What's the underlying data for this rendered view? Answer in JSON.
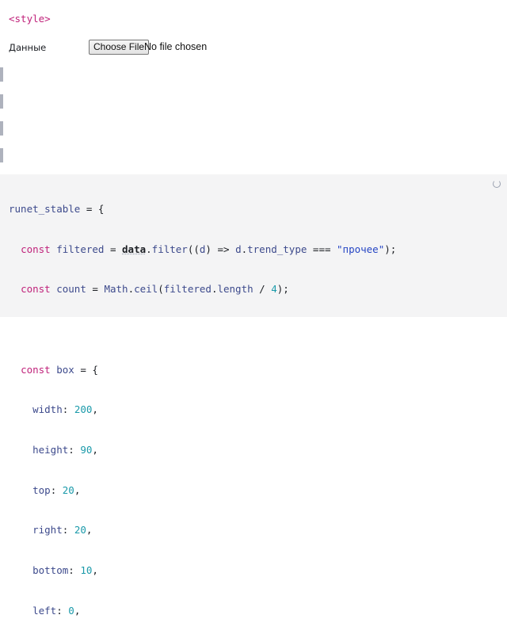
{
  "style_cell": {
    "text": "<style>"
  },
  "file_input": {
    "label": "Данные",
    "button_label": "Choose File",
    "status": "No file chosen"
  },
  "code": {
    "line1": {
      "name": "runet_stable",
      "op": " = {"
    },
    "line2": {
      "kw": "const",
      "name": "filtered",
      "eq": " = ",
      "ref": "data",
      "dot": ".",
      "method": "filter",
      "open": "((",
      "param": "d",
      "arrow": ") => ",
      "param2": "d",
      "dot2": ".",
      "prop": "trend_type",
      "cmp": " === ",
      "str": "\"прочее\"",
      "close": ");"
    },
    "line3": {
      "kw": "const",
      "name": "count",
      "eq": " = ",
      "obj": "Math",
      "dot": ".",
      "method": "ceil",
      "open": "(",
      "arg": "filtered",
      "dot2": ".",
      "prop": "length",
      "div": " / ",
      "num": "4",
      "close": ");"
    },
    "line5": {
      "kw": "const",
      "name": "box",
      "op": " = {"
    },
    "box_props": [
      {
        "key": "width",
        "value": "200"
      },
      {
        "key": "height",
        "value": "90"
      },
      {
        "key": "top",
        "value": "20"
      },
      {
        "key": "right",
        "value": "20"
      },
      {
        "key": "bottom",
        "value": "10"
      },
      {
        "key": "left",
        "value": "0"
      }
    ]
  },
  "colors": {
    "keyword": "#c0237b",
    "number": "#1b9aaa",
    "string": "#2545c4",
    "code_background": "#f4f4f5"
  }
}
